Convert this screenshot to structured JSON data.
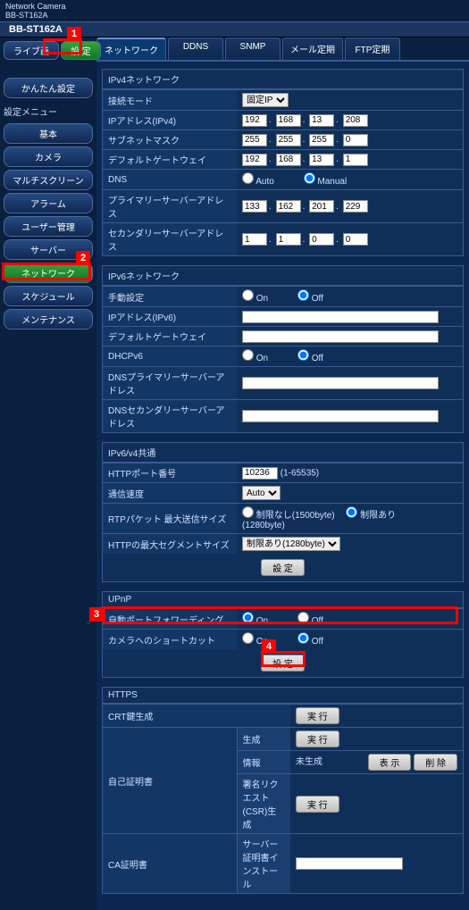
{
  "top": {
    "brand_line1": "Network Camera",
    "brand_line2": "BB-ST162A",
    "model": "BB-ST162A"
  },
  "toptabs": {
    "live": "ライブ画",
    "settings": "設 定"
  },
  "side": {
    "easy": "かんたん設定",
    "menu": "設定メニュー",
    "items": [
      "基本",
      "カメラ",
      "マルチスクリーン",
      "アラーム",
      "ユーザー管理",
      "サーバー",
      "ネットワーク",
      "スケジュール",
      "メンテナンス"
    ]
  },
  "maintabs": [
    "ネットワーク",
    "DDNS",
    "SNMP",
    "メール定期",
    "FTP定期"
  ],
  "ipv4": {
    "title": "IPv4ネットワーク",
    "mode_label": "接続モード",
    "mode_value": "固定IP",
    "addr_label": "IPアドレス(IPv4)",
    "addr": [
      "192",
      "168",
      "13",
      "208"
    ],
    "mask_label": "サブネットマスク",
    "mask": [
      "255",
      "255",
      "255",
      "0"
    ],
    "gw_label": "デフォルトゲートウェイ",
    "gw": [
      "192",
      "168",
      "13",
      "1"
    ],
    "dns_label": "DNS",
    "dns_auto": "Auto",
    "dns_manual": "Manual",
    "pdns_label": "プライマリーサーバーアドレス",
    "pdns": [
      "133",
      "162",
      "201",
      "229"
    ],
    "sdns_label": "セカンダリーサーバーアドレス",
    "sdns": [
      "1",
      "1",
      "0",
      "0"
    ]
  },
  "ipv6": {
    "title": "IPv6ネットワーク",
    "manual_label": "手動設定",
    "on": "On",
    "off": "Off",
    "addr_label": "IPアドレス(IPv6)",
    "gw_label": "デフォルトゲートウェイ",
    "dhcp_label": "DHCPv6",
    "pdns_label": "DNSプライマリーサーバーアドレス",
    "sdns_label": "DNSセカンダリーサーバーアドレス"
  },
  "common": {
    "title": "IPv6/v4共通",
    "http_label": "HTTPポート番号",
    "http_val": "10236",
    "http_range": "(1-65535)",
    "speed_label": "通信速度",
    "speed_val": "Auto",
    "rtp_label": "RTPパケット 最大送信サイズ",
    "rtp_a": "制限なし(1500byte)",
    "rtp_b": "制限あり(1280byte)",
    "seg_label": "HTTPの最大セグメントサイズ",
    "seg_val": "制限あり(1280byte)",
    "set_btn": "設 定"
  },
  "upnp": {
    "title": "UPnP",
    "autofw_label": "自動ポートフォワーディング",
    "on": "On",
    "off": "Off",
    "shortcut_label": "カメラへのショートカット",
    "set_btn": "設 定"
  },
  "https": {
    "title": "HTTPS",
    "crt_label": "CRT鍵生成",
    "exec": "実 行",
    "self_label": "自己証明書",
    "gen": "生成",
    "info": "情報",
    "info_val": "未生成",
    "view": "表 示",
    "del": "削 除",
    "csr_label": "署名リクエスト(CSR)生成",
    "ca_label": "CA証明書",
    "inst": "サーバー証明書インストール"
  }
}
